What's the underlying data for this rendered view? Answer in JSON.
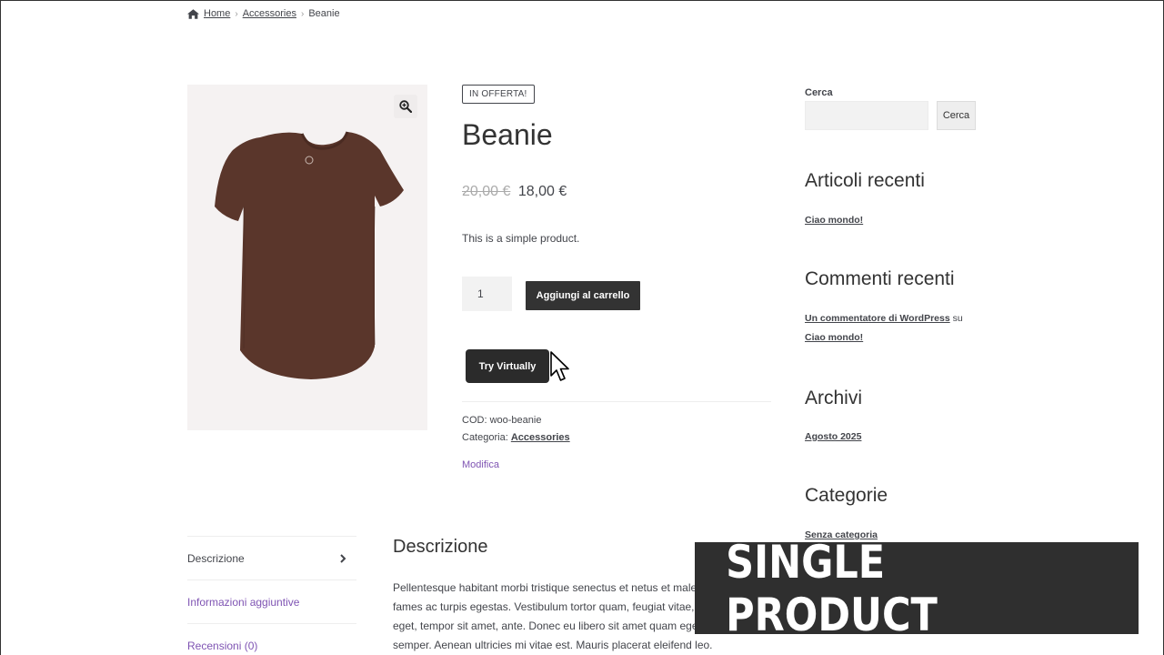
{
  "breadcrumb": {
    "home": "Home",
    "category": "Accessories",
    "current": "Beanie",
    "icon": "home-icon"
  },
  "product": {
    "badge": "IN OFFERTA!",
    "title": "Beanie",
    "old_price": "20,00 €",
    "price": "18,00 €",
    "short_description": "This is a simple product.",
    "quantity": "1",
    "add_to_cart_label": "Aggiungi al carrello",
    "try_virtually_label": "Try Virtually",
    "sku_label": "COD:",
    "sku": "woo-beanie",
    "category_label": "Categoria:",
    "category": "Accessories",
    "edit_label": "Modifica",
    "image_color": "#5a362b"
  },
  "sidebar": {
    "search_label": "Cerca",
    "search_button": "Cerca",
    "recent_posts_title": "Articoli recenti",
    "recent_post": "Ciao mondo!",
    "recent_comments_title": "Commenti recenti",
    "comment_author": "Un commentatore di WordPress",
    "comment_on": "su",
    "comment_post": "Ciao mondo!",
    "archives_title": "Archivi",
    "archive_item": "Agosto 2025",
    "categories_title": "Categorie",
    "category_item": "Senza categoria"
  },
  "tabs": [
    {
      "label": "Descrizione"
    },
    {
      "label": "Informazioni aggiuntive"
    },
    {
      "label": "Recensioni (0)"
    }
  ],
  "description": {
    "title": "Descrizione",
    "body": "Pellentesque habitant morbi tristique senectus et netus et malesuada fames ac turpis egestas. Vestibulum tortor quam, feugiat vitae, ultricies eget, tempor sit amet, ante. Donec eu libero sit amet quam egestas semper. Aenean ultricies mi vitae est. Mauris placerat eleifend leo."
  },
  "overlay": {
    "text": "SINGLE PRODUCT"
  },
  "colors": {
    "accent_link": "#7f54b3",
    "button_dark": "#333333",
    "overlay_bg": "#2f2f2f"
  }
}
